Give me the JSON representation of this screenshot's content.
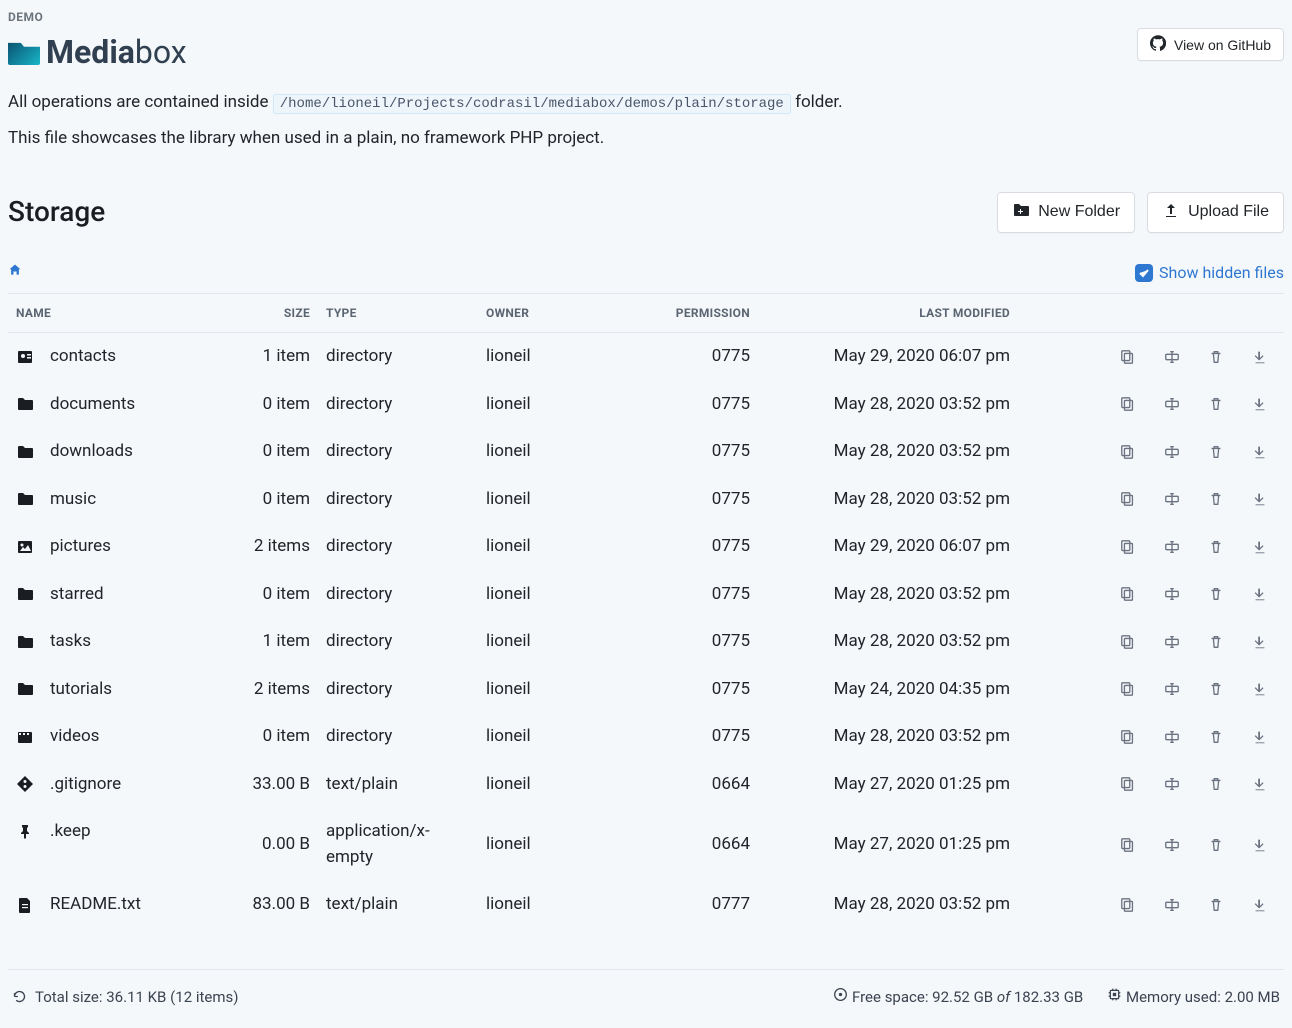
{
  "header": {
    "demo_label": "DEMO",
    "brand_bold": "Media",
    "brand_light": "box",
    "github_label": "View on GitHub"
  },
  "intro": {
    "line1_pre": "All operations are contained inside ",
    "path": "/home/lioneil/Projects/codrasil/mediabox/demos/plain/storage",
    "line1_post": " folder.",
    "line2": "This file showcases the library when used in a plain, no framework PHP project."
  },
  "storage": {
    "title": "Storage",
    "new_folder": "New Folder",
    "upload_file": "Upload File",
    "show_hidden": "Show hidden files"
  },
  "columns": {
    "name": "NAME",
    "size": "SIZE",
    "type": "TYPE",
    "owner": "OWNER",
    "permission": "PERMISSION",
    "last_modified": "LAST MODIFIED"
  },
  "rows": [
    {
      "icon": "contact",
      "name": "contacts",
      "size": "1 item",
      "type": "directory",
      "owner": "lioneil",
      "perm": "0775",
      "mod": "May 29, 2020 06:07 pm"
    },
    {
      "icon": "folder",
      "name": "documents",
      "size": "0 item",
      "type": "directory",
      "owner": "lioneil",
      "perm": "0775",
      "mod": "May 28, 2020 03:52 pm"
    },
    {
      "icon": "folder",
      "name": "downloads",
      "size": "0 item",
      "type": "directory",
      "owner": "lioneil",
      "perm": "0775",
      "mod": "May 28, 2020 03:52 pm"
    },
    {
      "icon": "folder",
      "name": "music",
      "size": "0 item",
      "type": "directory",
      "owner": "lioneil",
      "perm": "0775",
      "mod": "May 28, 2020 03:52 pm"
    },
    {
      "icon": "image",
      "name": "pictures",
      "size": "2 items",
      "type": "directory",
      "owner": "lioneil",
      "perm": "0775",
      "mod": "May 29, 2020 06:07 pm"
    },
    {
      "icon": "folder",
      "name": "starred",
      "size": "0 item",
      "type": "directory",
      "owner": "lioneil",
      "perm": "0775",
      "mod": "May 28, 2020 03:52 pm"
    },
    {
      "icon": "folder",
      "name": "tasks",
      "size": "1 item",
      "type": "directory",
      "owner": "lioneil",
      "perm": "0775",
      "mod": "May 28, 2020 03:52 pm"
    },
    {
      "icon": "folder",
      "name": "tutorials",
      "size": "2 items",
      "type": "directory",
      "owner": "lioneil",
      "perm": "0775",
      "mod": "May 24, 2020 04:35 pm"
    },
    {
      "icon": "video",
      "name": "videos",
      "size": "0 item",
      "type": "directory",
      "owner": "lioneil",
      "perm": "0775",
      "mod": "May 28, 2020 03:52 pm"
    },
    {
      "icon": "git",
      "name": ".gitignore",
      "size": "33.00 B",
      "type": "text/plain",
      "owner": "lioneil",
      "perm": "0664",
      "mod": "May 27, 2020 01:25 pm"
    },
    {
      "icon": "pin",
      "name": ".keep",
      "size": "0.00 B",
      "type": "application/x-empty",
      "owner": "lioneil",
      "perm": "0664",
      "mod": "May 27, 2020 01:25 pm"
    },
    {
      "icon": "file",
      "name": "README.txt",
      "size": "83.00 B",
      "type": "text/plain",
      "owner": "lioneil",
      "perm": "0777",
      "mod": "May 28, 2020 03:52 pm"
    }
  ],
  "footer": {
    "total_label": "Total size: ",
    "total_value": "36.11 KB (12 items)",
    "free_label": "Free space: ",
    "free_used": "92.52 GB",
    "of": " of ",
    "free_total": "182.33 GB",
    "memory_label": "Memory used: ",
    "memory_value": "2.00 MB"
  }
}
